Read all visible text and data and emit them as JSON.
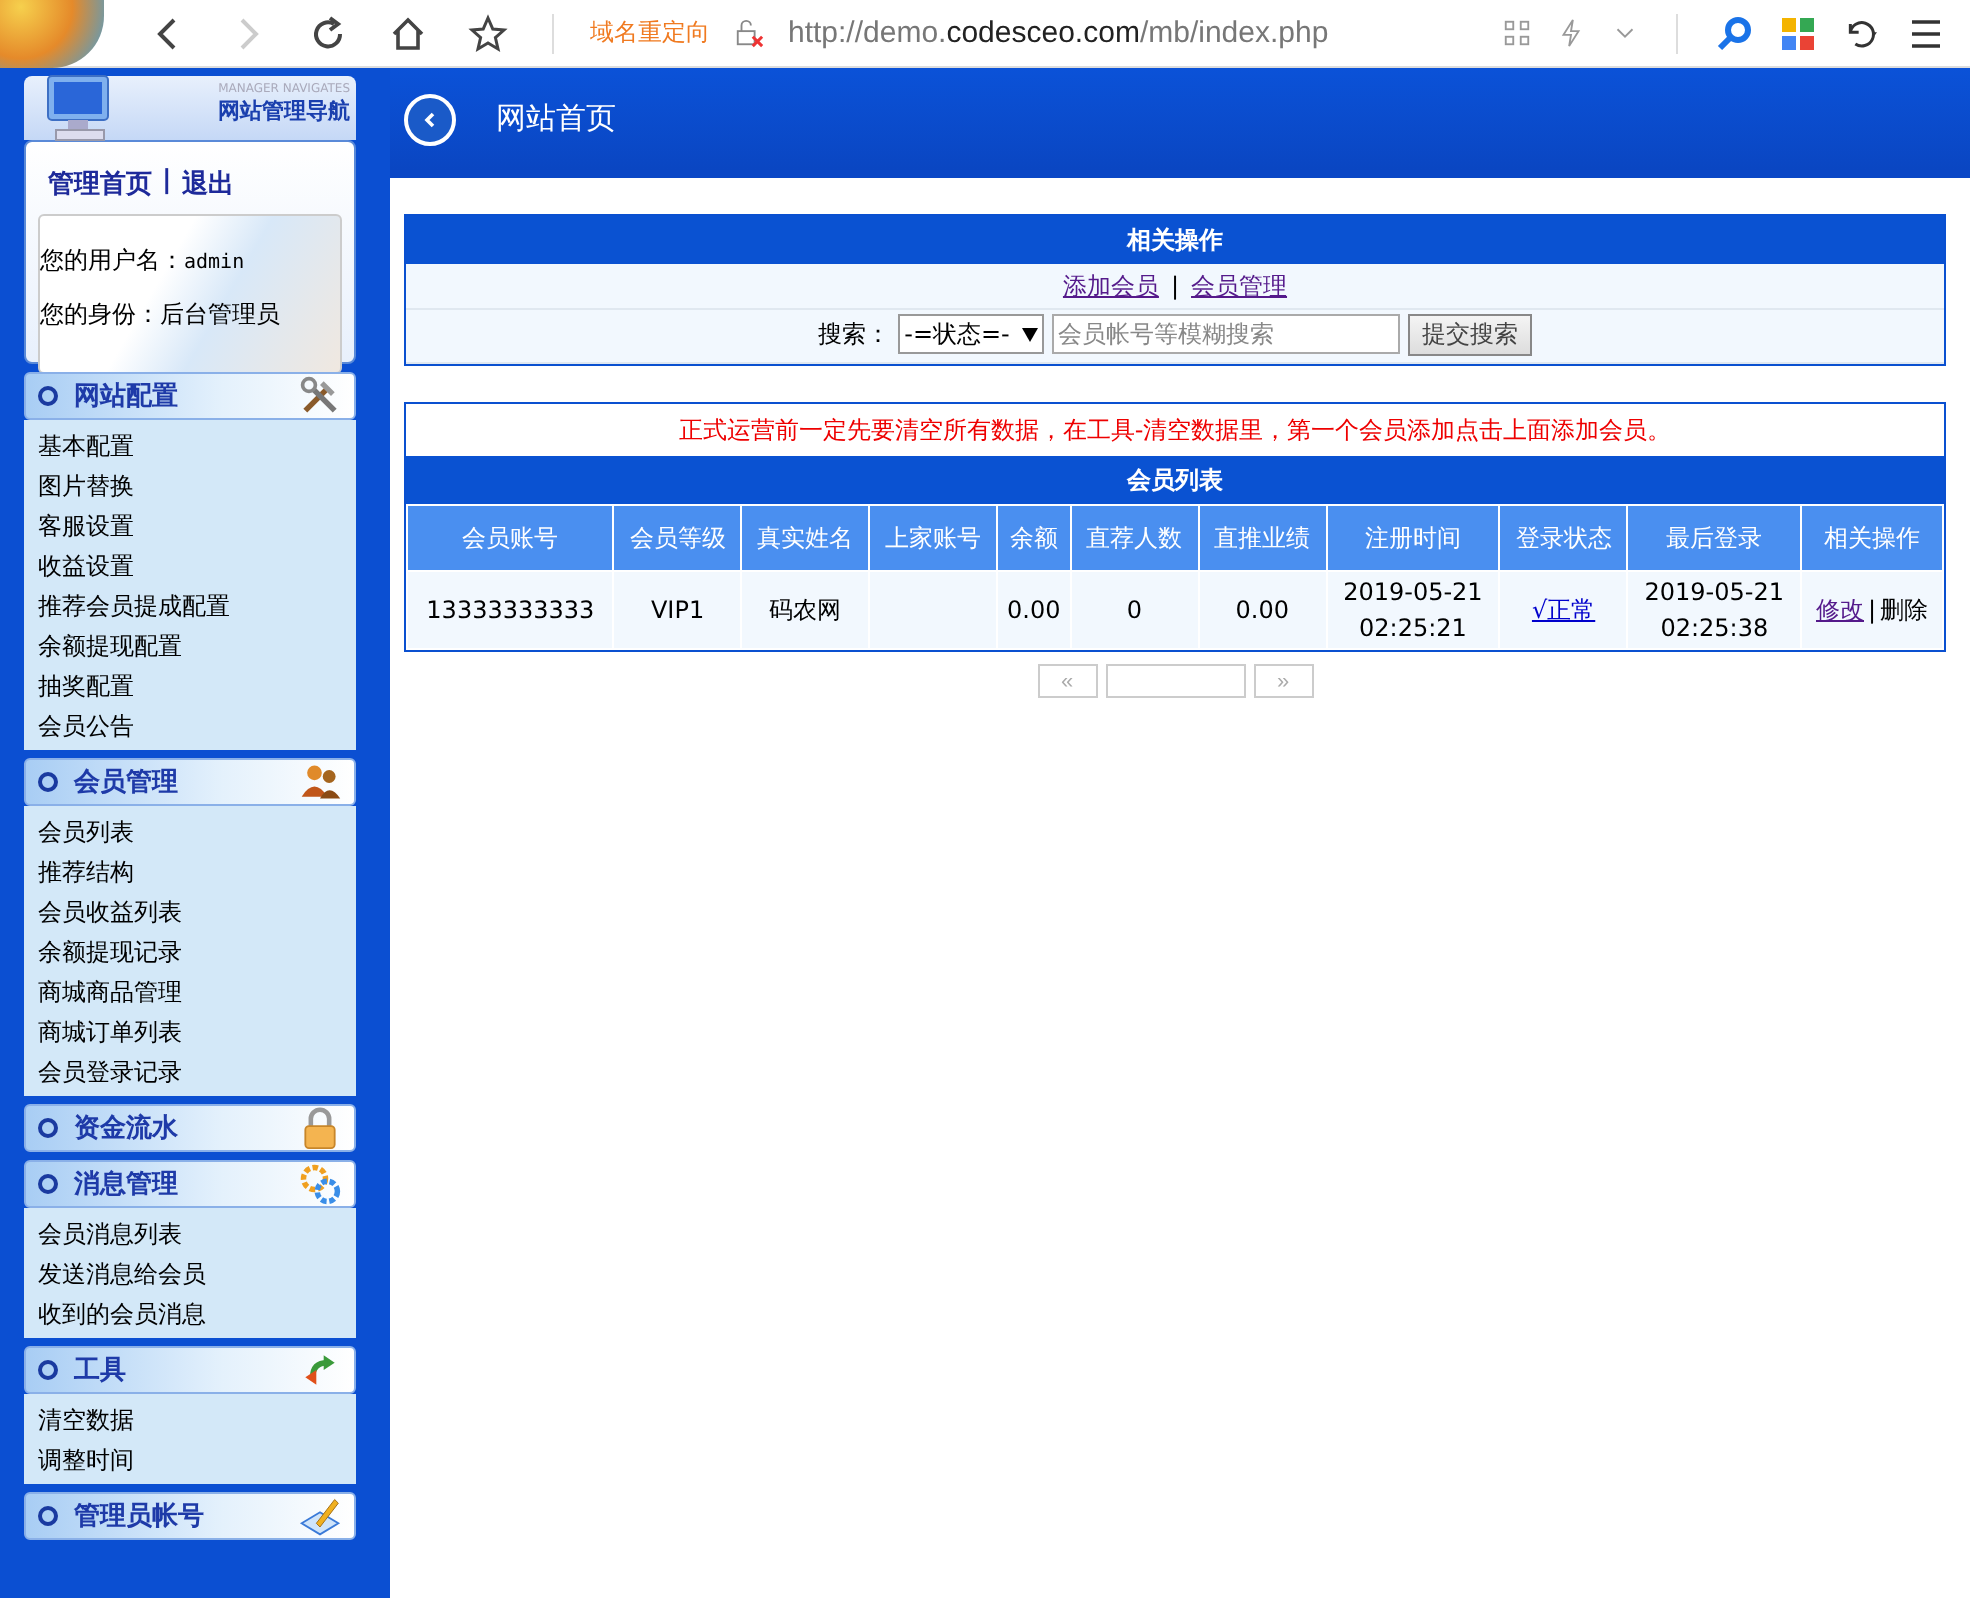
{
  "browser": {
    "redirect_label": "域名重定向",
    "url_prefix": "http://demo.",
    "url_domain": "codesceo.com",
    "url_path": "/mb/index.php"
  },
  "nav": {
    "subtitle": "MANAGER NAVIGATES",
    "title": "网站管理导航",
    "links": [
      "管理首页",
      "退出"
    ],
    "separator": "|",
    "username_label": "您的用户名：",
    "username": "admin",
    "role_label": "您的身份：",
    "role": "后台管理员"
  },
  "sections": [
    {
      "title": "网站配置",
      "items": [
        "基本配置",
        "图片替换",
        "客服设置",
        "收益设置",
        "推荐会员提成配置",
        "余额提现配置",
        "抽奖配置",
        "会员公告"
      ]
    },
    {
      "title": "会员管理",
      "items": [
        "会员列表",
        "推荐结构",
        "会员收益列表",
        "余额提现记录",
        "商城商品管理",
        "商城订单列表",
        "会员登录记录"
      ]
    },
    {
      "title": "资金流水"
    },
    {
      "title": "消息管理",
      "items": [
        "会员消息列表",
        "发送消息给会员",
        "收到的会员消息"
      ]
    },
    {
      "title": "工具",
      "items": [
        "清空数据",
        "调整时间"
      ]
    },
    {
      "title": "管理员帐号"
    }
  ],
  "page_title": "网站首页",
  "operations": {
    "title": "相关操作",
    "links": [
      "添加会员",
      "会员管理"
    ],
    "separator": "|",
    "search_label": "搜索：",
    "status_select": "-=状态=-",
    "search_placeholder": "会员帐号等模糊搜索",
    "submit": "提交搜索"
  },
  "notice": "正式运营前一定先要清空所有数据，在工具-清空数据里，第一个会员添加点击上面添加会员。",
  "table": {
    "title": "会员列表",
    "columns": [
      "会员账号",
      "会员等级",
      "真实姓名",
      "上家账号",
      "余额",
      "直荐人数",
      "直推业绩",
      "注册时间",
      "登录状态",
      "最后登录",
      "相关操作"
    ],
    "rows": [
      {
        "account": "13333333333",
        "level": "VIP1",
        "name": "码农网",
        "balance": "0.00",
        "referrals": "0",
        "performance": "0.00",
        "registered": [
          "2019-05-21",
          "02:25:21"
        ],
        "status": "√正常",
        "last_login": [
          "2019-05-21",
          "02:25:38"
        ],
        "actions": [
          "修改",
          "删除"
        ],
        "actions_separator": "|"
      }
    ]
  },
  "pagination": {
    "prev": "«",
    "next": "»"
  }
}
